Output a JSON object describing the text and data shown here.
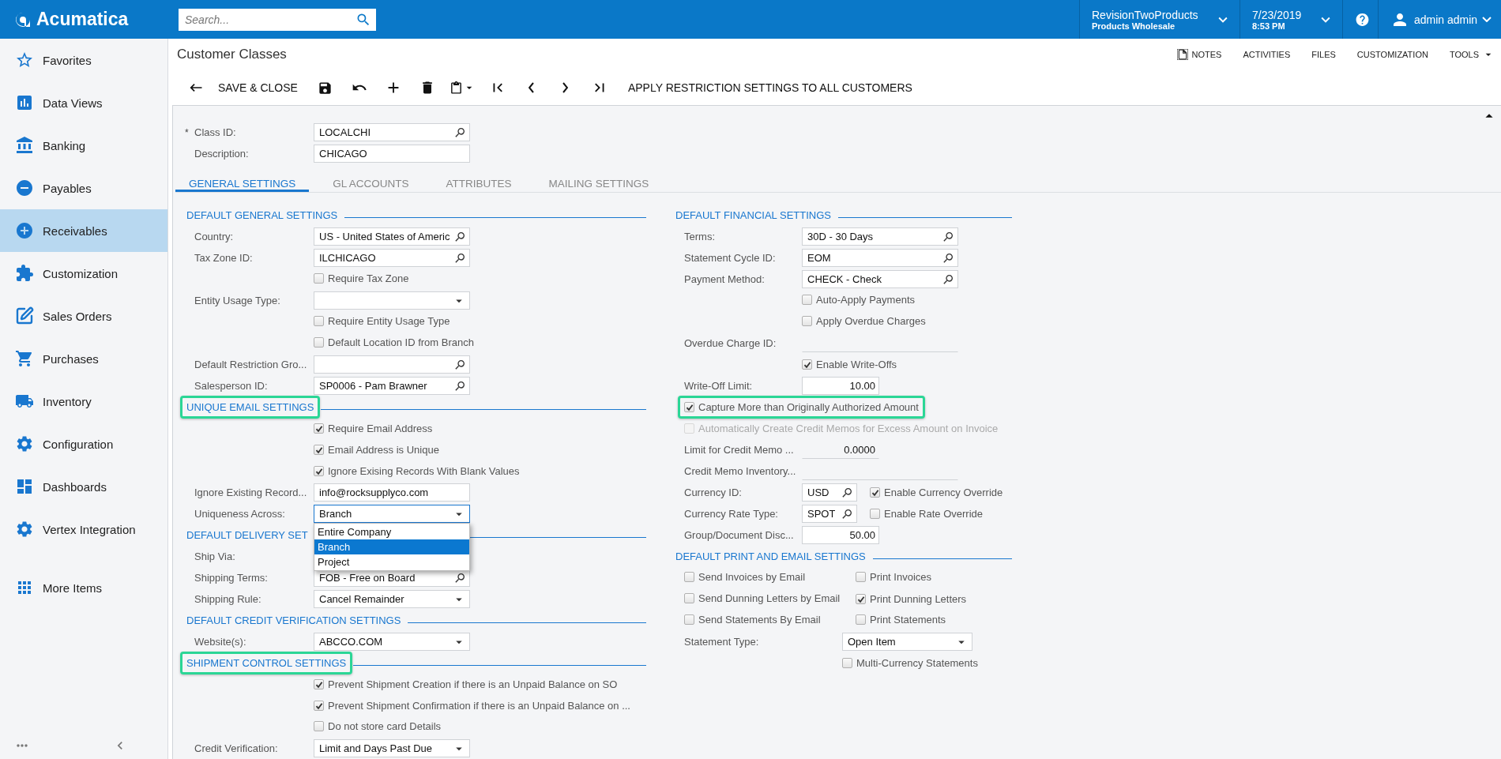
{
  "app": {
    "logo": "Acumatica",
    "search": {
      "placeholder": "Search..."
    },
    "company": {
      "name": "RevisionTwoProducts",
      "branch": "Products Wholesale"
    },
    "date": {
      "date": "7/23/2019",
      "time": "8:53 PM"
    },
    "user": "admin admin"
  },
  "sidebar": {
    "items": [
      {
        "label": "Favorites",
        "selected": false
      },
      {
        "label": "Data Views",
        "selected": false
      },
      {
        "label": "Banking",
        "selected": false
      },
      {
        "label": "Payables",
        "selected": false
      },
      {
        "label": "Receivables",
        "selected": true
      },
      {
        "label": "Customization",
        "selected": false
      },
      {
        "label": "Sales Orders",
        "selected": false
      },
      {
        "label": "Purchases",
        "selected": false
      },
      {
        "label": "Inventory",
        "selected": false
      },
      {
        "label": "Configuration",
        "selected": false
      },
      {
        "label": "Dashboards",
        "selected": false
      },
      {
        "label": "Vertex Integration",
        "selected": false
      }
    ],
    "more": "More Items"
  },
  "screen": {
    "title": "Customer Classes",
    "links": [
      "NOTES",
      "ACTIVITIES",
      "FILES",
      "CUSTOMIZATION",
      "TOOLS"
    ]
  },
  "toolbar": {
    "save_close": "SAVE & CLOSE",
    "apply": "APPLY RESTRICTION SETTINGS TO ALL CUSTOMERS"
  },
  "header_fields": [
    {
      "kind": "lookup",
      "marker": "*",
      "label": "Class ID:",
      "value": "LOCALCHI"
    },
    {
      "kind": "text",
      "label": "Description:",
      "value": "CHICAGO"
    }
  ],
  "tabs": [
    {
      "label": "GENERAL SETTINGS",
      "selected": true
    },
    {
      "label": "GL ACCOUNTS",
      "selected": false
    },
    {
      "label": "ATTRIBUTES",
      "selected": false
    },
    {
      "label": "MAILING SETTINGS",
      "selected": false
    }
  ],
  "left": [
    {
      "kind": "section",
      "title": "DEFAULT GENERAL SETTINGS",
      "highlighted": false
    },
    {
      "kind": "lookup",
      "label": "Country:",
      "value": "US - United States of Americ"
    },
    {
      "kind": "lookup",
      "label": "Tax Zone ID:",
      "value": "ILCHICAGO"
    },
    {
      "kind": "check",
      "label": "Require Tax Zone",
      "checked": false
    },
    {
      "kind": "select",
      "label": "Entity Usage Type:"
    },
    {
      "kind": "check",
      "label": "Require Entity Usage Type",
      "checked": false
    },
    {
      "kind": "check",
      "label": "Default Location ID from Branch",
      "checked": false
    },
    {
      "kind": "lookup",
      "label": "Default Restriction Gro..."
    },
    {
      "kind": "lookup",
      "label": "Salesperson ID:",
      "value": "SP0006 - Pam Brawner"
    },
    {
      "kind": "section",
      "title": "UNIQUE EMAIL SETTINGS",
      "highlighted": true
    },
    {
      "kind": "check",
      "label": "Require Email Address",
      "checked": true
    },
    {
      "kind": "check",
      "label": "Email Address is Unique",
      "checked": true
    },
    {
      "kind": "check",
      "label": "Ignore Exising Records With Blank Values",
      "checked": true
    },
    {
      "kind": "text",
      "label": "Ignore Existing Record...",
      "value": "info@rocksupplyco.com"
    },
    {
      "kind": "select",
      "label": "Uniqueness Across:",
      "value": "Branch",
      "open": true,
      "options": [
        {
          "label": "Entire Company",
          "selected": false
        },
        {
          "label": "Branch",
          "selected": true
        },
        {
          "label": "Project",
          "selected": false
        }
      ]
    },
    {
      "kind": "section",
      "title": "DEFAULT DELIVERY SET",
      "highlighted": false
    },
    {
      "kind": "label",
      "label": "Ship Via:"
    },
    {
      "kind": "lookup",
      "label": "Shipping Terms:",
      "value": "FOB - Free on Board"
    },
    {
      "kind": "select",
      "label": "Shipping Rule:",
      "value": "Cancel Remainder"
    },
    {
      "kind": "section",
      "title": "DEFAULT CREDIT VERIFICATION SETTINGS",
      "highlighted": false
    },
    {
      "kind": "select",
      "label": "Website(s):",
      "value": "ABCCO.COM"
    },
    {
      "kind": "section",
      "title": "SHIPMENT CONTROL SETTINGS",
      "highlighted": true
    },
    {
      "kind": "check",
      "label": "Prevent Shipment Creation if there is an Unpaid Balance on SO",
      "checked": true
    },
    {
      "kind": "check",
      "label": "Prevent Shipment Confirmation if there is an Unpaid Balance on ...",
      "checked": true
    },
    {
      "kind": "check",
      "label": "Do not store card Details",
      "checked": false
    },
    {
      "kind": "select",
      "label": "Credit Verification:",
      "value": "Limit and Days Past Due"
    }
  ],
  "right": [
    {
      "kind": "section",
      "title": "DEFAULT FINANCIAL SETTINGS",
      "highlighted": false
    },
    {
      "kind": "lookup",
      "label": "Terms:",
      "value": "30D - 30 Days"
    },
    {
      "kind": "lookup",
      "label": "Statement Cycle ID:",
      "value": "EOM"
    },
    {
      "kind": "lookup",
      "label": "Payment Method:",
      "value": "CHECK - Check"
    },
    {
      "kind": "check",
      "label": "Auto-Apply Payments",
      "checked": false
    },
    {
      "kind": "check",
      "label": "Apply Overdue Charges",
      "checked": false
    },
    {
      "kind": "line",
      "label": "Overdue Charge ID:"
    },
    {
      "kind": "check",
      "label": "Enable Write-Offs",
      "checked": true
    },
    {
      "kind": "number",
      "label": "Write-Off Limit:",
      "value": "10.00"
    },
    {
      "kind": "wide_check",
      "label": "Capture More than Originally Authorized Amount",
      "checked": true,
      "disabled": false,
      "highlighted": true
    },
    {
      "kind": "wide_check",
      "label": "Automatically Create Credit Memos for Excess Amount on Invoice",
      "checked": false,
      "disabled": true,
      "highlighted": false
    },
    {
      "kind": "line_number",
      "label": "Limit for Credit Memo ...",
      "value": "0.0000"
    },
    {
      "kind": "line",
      "label": "Credit Memo Inventory..."
    },
    {
      "kind": "code_check",
      "label": "Currency ID:",
      "value": "USD",
      "check": {
        "label": "Enable Currency Override",
        "checked": true
      }
    },
    {
      "kind": "code_check",
      "label": "Currency Rate Type:",
      "value": "SPOT",
      "check": {
        "label": "Enable Rate Override",
        "checked": false
      }
    },
    {
      "kind": "number",
      "label": "Group/Document Disc...",
      "value": "50.00"
    },
    {
      "kind": "section",
      "title": "DEFAULT PRINT AND EMAIL SETTINGS",
      "highlighted": false
    },
    {
      "kind": "check_pair",
      "items": [
        {
          "label": "Send Invoices by Email",
          "checked": false
        },
        {
          "label": "Print Invoices",
          "checked": false
        }
      ]
    },
    {
      "kind": "check_pair",
      "items": [
        {
          "label": "Send Dunning Letters by Email",
          "checked": false
        },
        {
          "label": "Print Dunning Letters",
          "checked": true
        }
      ]
    },
    {
      "kind": "check_pair",
      "items": [
        {
          "label": "Send Statements By Email",
          "checked": false
        },
        {
          "label": "Print Statements",
          "checked": false
        }
      ]
    },
    {
      "kind": "wide_select",
      "label": "Statement Type:",
      "value": "Open Item"
    },
    {
      "kind": "offset_check",
      "label": "Multi-Currency Statements",
      "checked": false
    }
  ]
}
